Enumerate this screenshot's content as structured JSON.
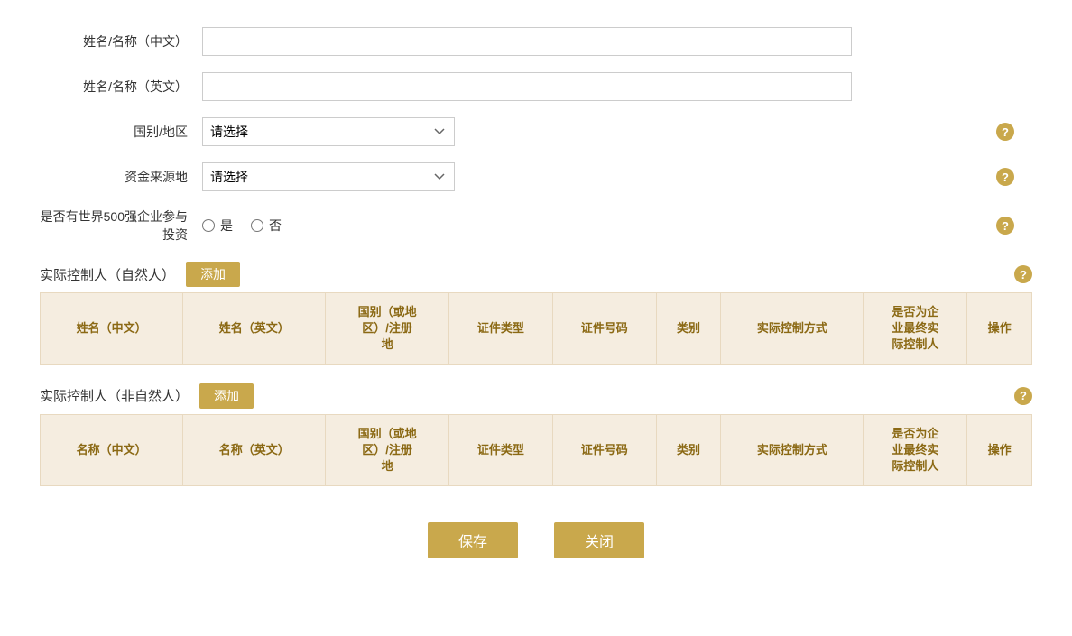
{
  "form": {
    "name_zh_label": "姓名/名称（中文）",
    "name_en_label": "姓名/名称（英文）",
    "country_label": "国别/地区",
    "fund_source_label": "资金来源地",
    "fortune500_label": "是否有世界500强企业参与投资",
    "country_placeholder": "请选择",
    "fund_source_placeholder": "请选择",
    "radio_yes": "是",
    "radio_no": "否"
  },
  "natural_controller": {
    "section_title": "实际控制人（自然人）",
    "add_label": "添加",
    "columns": [
      "姓名（中文）",
      "姓名（英文）",
      "国别（或地区）/注册地",
      "证件类型",
      "证件号码",
      "类别",
      "实际控制方式",
      "是否为企业最终实际控制人",
      "操作"
    ]
  },
  "non_natural_controller": {
    "section_title": "实际控制人（非自然人）",
    "add_label": "添加",
    "columns": [
      "名称（中文）",
      "名称（英文）",
      "国别（或地区）/注册地",
      "证件类型",
      "证件号码",
      "类别",
      "实际控制方式",
      "是否为企业最终实际控制人",
      "操作"
    ]
  },
  "buttons": {
    "save": "保存",
    "close": "关闭"
  },
  "help_icon": "?",
  "colors": {
    "gold": "#c9a84c",
    "table_header_bg": "#f5ede0",
    "table_header_text": "#8b6914"
  }
}
